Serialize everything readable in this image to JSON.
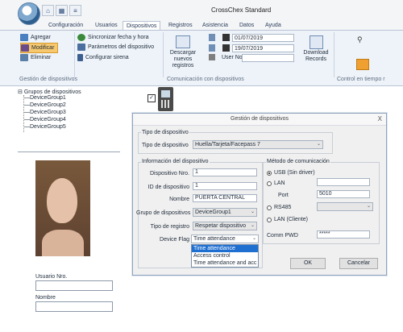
{
  "window": {
    "title": "CrossChex Standard"
  },
  "quick_access": {
    "icons": [
      "home-icon",
      "grid-icon",
      "dropdown-icon"
    ]
  },
  "tabs": [
    {
      "label": "Configuración"
    },
    {
      "label": "Usuarios"
    },
    {
      "label": "Dispositivos",
      "active": true
    },
    {
      "label": "Registros"
    },
    {
      "label": "Asistencia"
    },
    {
      "label": "Datos"
    },
    {
      "label": "Ayuda"
    }
  ],
  "ribbon": {
    "device_group": {
      "add": "Agregar",
      "modify": "Modificar",
      "delete": "Eliminar",
      "label": "Gestión de dispositivos"
    },
    "device_actions": {
      "sync_time": "Sincronizar fecha y hora",
      "params": "Parámetros del dispositivo",
      "siren": "Configurar sirena"
    },
    "comm": {
      "download_new": "Descargar\nnuevos registros",
      "date_from": "01/07/2019",
      "date_to": "19/07/2019",
      "user_no_label": "User No.",
      "download_records": "Download\nRecords",
      "label": "Comunicación con dispositivos"
    },
    "realtime": {
      "label": "Control en tiempo r"
    }
  },
  "tree": {
    "root": "Grupos de dispositivos",
    "children": [
      "DeviceGroup1",
      "DeviceGroup2",
      "DeviceGroup3",
      "DeviceGroup4",
      "DeviceGroup5"
    ]
  },
  "left_panel": {
    "user_no_label": "Usuario Nro.",
    "name_label": "Nombre"
  },
  "dialog": {
    "title": "Gestión de dispositivos",
    "device_type_section": "Tipo de dispositivo",
    "device_type_label": "Tipo de dispositivo",
    "device_type_value": "Huella/Tarjeta/Facepass 7",
    "info_section": "Información del dispositivo",
    "device_no_label": "Dispositivo Nro.",
    "device_no_value": "1",
    "device_id_label": "ID de dispositivo",
    "device_id_value": "1",
    "name_label": "Nombre",
    "name_value": "PUERTA CENTRAL",
    "group_label": "Grupo de dispositivos",
    "group_value": "DeviceGroup1",
    "record_type_label": "Tipo de registro",
    "record_type_value": "Respetar dispositivo",
    "device_flag_label": "Device Flag",
    "device_flag_value": "Time attendance",
    "device_flag_options": [
      "Time attendance",
      "Access control",
      "Time attendance and acc"
    ],
    "comm_section": "Método de comunicación",
    "usb_label": "USB (Sin driver)",
    "lan_label": "LAN",
    "port_label": "Port",
    "port_value": "5010",
    "rs485_label": "RS485",
    "lan_client_label": "LAN (Cliente)",
    "comm_pwd_label": "Comm PWD",
    "comm_pwd_value": "*****",
    "ok": "OK",
    "cancel": "Cancelar",
    "close": "X"
  },
  "colors": {
    "ribbon_bg": "#eef3f9",
    "tab_text": "#2a3c59",
    "selection_blue": "#1f6fd1",
    "accent_orange": "#f0a030"
  }
}
